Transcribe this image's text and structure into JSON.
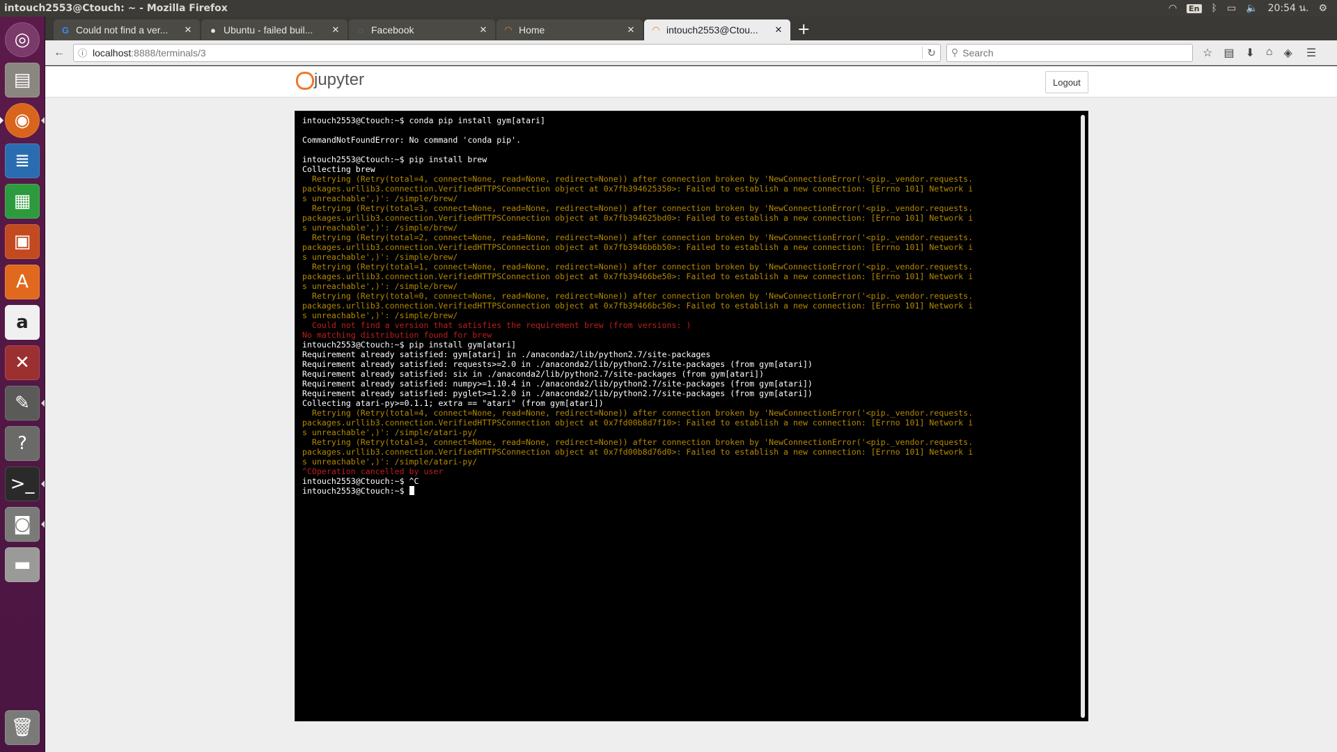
{
  "window": {
    "title": "intouch2553@Ctouch: ~ - Mozilla Firefox"
  },
  "tray": {
    "keyboard": "En",
    "time": "20:54 น."
  },
  "launcher": [
    "ubuntu-dash",
    "files",
    "firefox",
    "writer",
    "calc",
    "impress",
    "software-center",
    "amazon",
    "system-settings",
    "text-editor",
    "help",
    "terminal",
    "screenshot",
    "disk",
    "trash"
  ],
  "tabs": [
    {
      "label": "Could not find a ver...",
      "icon": "google-icon"
    },
    {
      "label": "Ubuntu - failed buil...",
      "icon": "github-icon"
    },
    {
      "label": "Facebook",
      "icon": "loading-icon"
    },
    {
      "label": "Home",
      "icon": "jupyter-icon"
    },
    {
      "label": "intouch2553@Ctou...",
      "icon": "jupyter-icon"
    }
  ],
  "url": {
    "host": "localhost",
    "path": ":8888/terminals/3"
  },
  "search": {
    "placeholder": "Search"
  },
  "jupyter": {
    "brand": "jupyter",
    "logout": "Logout"
  },
  "terminal_lines": [
    {
      "t": "intouch2553@Ctouch:~$ conda pip install gym[atari]",
      "k": "normal"
    },
    {
      "t": "",
      "k": "blank"
    },
    {
      "t": "CommandNotFoundError: No command 'conda pip'.",
      "k": "normal"
    },
    {
      "t": "",
      "k": "blank"
    },
    {
      "t": "intouch2553@Ctouch:~$ pip install brew",
      "k": "normal"
    },
    {
      "t": "Collecting brew",
      "k": "normal"
    },
    {
      "t": "  Retrying (Retry(total=4, connect=None, read=None, redirect=None)) after connection broken by 'NewConnectionError('<pip._vendor.requests.",
      "k": "warn"
    },
    {
      "t": "packages.urllib3.connection.VerifiedHTTPSConnection object at 0x7fb394625350>: Failed to establish a new connection: [Errno 101] Network i",
      "k": "warn"
    },
    {
      "t": "s unreachable',)': /simple/brew/",
      "k": "warn"
    },
    {
      "t": "  Retrying (Retry(total=3, connect=None, read=None, redirect=None)) after connection broken by 'NewConnectionError('<pip._vendor.requests.",
      "k": "warn"
    },
    {
      "t": "packages.urllib3.connection.VerifiedHTTPSConnection object at 0x7fb394625bd0>: Failed to establish a new connection: [Errno 101] Network i",
      "k": "warn"
    },
    {
      "t": "s unreachable',)': /simple/brew/",
      "k": "warn"
    },
    {
      "t": "  Retrying (Retry(total=2, connect=None, read=None, redirect=None)) after connection broken by 'NewConnectionError('<pip._vendor.requests.",
      "k": "warn"
    },
    {
      "t": "packages.urllib3.connection.VerifiedHTTPSConnection object at 0x7fb3946b6b50>: Failed to establish a new connection: [Errno 101] Network i",
      "k": "warn"
    },
    {
      "t": "s unreachable',)': /simple/brew/",
      "k": "warn"
    },
    {
      "t": "  Retrying (Retry(total=1, connect=None, read=None, redirect=None)) after connection broken by 'NewConnectionError('<pip._vendor.requests.",
      "k": "warn"
    },
    {
      "t": "packages.urllib3.connection.VerifiedHTTPSConnection object at 0x7fb39466be50>: Failed to establish a new connection: [Errno 101] Network i",
      "k": "warn"
    },
    {
      "t": "s unreachable',)': /simple/brew/",
      "k": "warn"
    },
    {
      "t": "  Retrying (Retry(total=0, connect=None, read=None, redirect=None)) after connection broken by 'NewConnectionError('<pip._vendor.requests.",
      "k": "warn"
    },
    {
      "t": "packages.urllib3.connection.VerifiedHTTPSConnection object at 0x7fb39466bc50>: Failed to establish a new connection: [Errno 101] Network i",
      "k": "warn"
    },
    {
      "t": "s unreachable',)': /simple/brew/",
      "k": "warn"
    },
    {
      "t": "  Could not find a version that satisfies the requirement brew (from versions: )",
      "k": "err"
    },
    {
      "t": "No matching distribution found for brew",
      "k": "err"
    },
    {
      "t": "intouch2553@Ctouch:~$ pip install gym[atari]",
      "k": "normal"
    },
    {
      "t": "Requirement already satisfied: gym[atari] in ./anaconda2/lib/python2.7/site-packages",
      "k": "normal"
    },
    {
      "t": "Requirement already satisfied: requests>=2.0 in ./anaconda2/lib/python2.7/site-packages (from gym[atari])",
      "k": "normal"
    },
    {
      "t": "Requirement already satisfied: six in ./anaconda2/lib/python2.7/site-packages (from gym[atari])",
      "k": "normal"
    },
    {
      "t": "Requirement already satisfied: numpy>=1.10.4 in ./anaconda2/lib/python2.7/site-packages (from gym[atari])",
      "k": "normal"
    },
    {
      "t": "Requirement already satisfied: pyglet>=1.2.0 in ./anaconda2/lib/python2.7/site-packages (from gym[atari])",
      "k": "normal"
    },
    {
      "t": "Collecting atari-py>=0.1.1; extra == \"atari\" (from gym[atari])",
      "k": "normal"
    },
    {
      "t": "  Retrying (Retry(total=4, connect=None, read=None, redirect=None)) after connection broken by 'NewConnectionError('<pip._vendor.requests.",
      "k": "warn"
    },
    {
      "t": "packages.urllib3.connection.VerifiedHTTPSConnection object at 0x7fd00b8d7f10>: Failed to establish a new connection: [Errno 101] Network i",
      "k": "warn"
    },
    {
      "t": "s unreachable',)': /simple/atari-py/",
      "k": "warn"
    },
    {
      "t": "  Retrying (Retry(total=3, connect=None, read=None, redirect=None)) after connection broken by 'NewConnectionError('<pip._vendor.requests.",
      "k": "warn"
    },
    {
      "t": "packages.urllib3.connection.VerifiedHTTPSConnection object at 0x7fd00b8d76d0>: Failed to establish a new connection: [Errno 101] Network i",
      "k": "warn"
    },
    {
      "t": "s unreachable',)': /simple/atari-py/",
      "k": "warn"
    },
    {
      "t": "^COperation cancelled by user",
      "k": "err"
    },
    {
      "t": "intouch2553@Ctouch:~$ ^C",
      "k": "normal"
    },
    {
      "t": "intouch2553@Ctouch:~$ ",
      "k": "prompt"
    }
  ],
  "colors": {
    "warn": "#b58900",
    "err": "#c01c1c",
    "launcher": "#5b1b4a",
    "jupyter_orange": "#f37626"
  }
}
